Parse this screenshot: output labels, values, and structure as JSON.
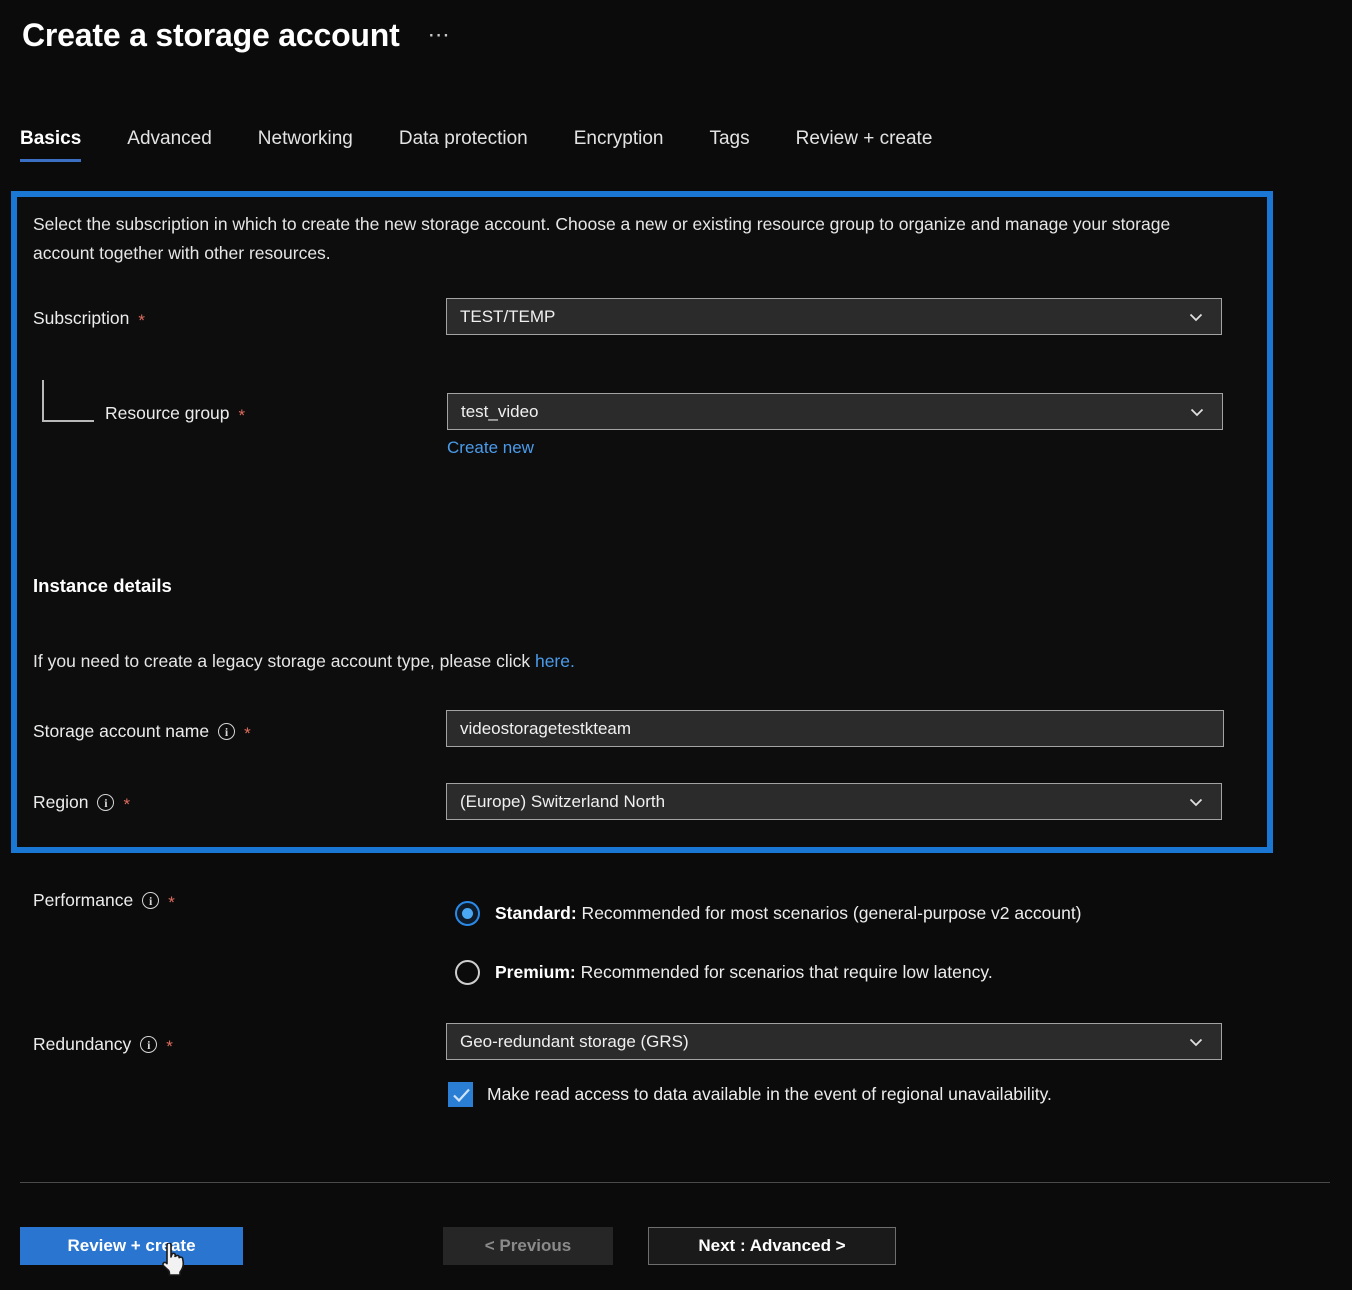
{
  "header": {
    "title": "Create a storage account",
    "more_label": "⋯"
  },
  "tabs": [
    {
      "label": "Basics",
      "active": true
    },
    {
      "label": "Advanced",
      "active": false
    },
    {
      "label": "Networking",
      "active": false
    },
    {
      "label": "Data protection",
      "active": false
    },
    {
      "label": "Encryption",
      "active": false
    },
    {
      "label": "Tags",
      "active": false
    },
    {
      "label": "Review + create",
      "active": false
    }
  ],
  "basics": {
    "intro": "Select the subscription in which to create the new storage account. Choose a new or existing resource group to organize and manage your storage account together with other resources.",
    "subscription": {
      "label": "Subscription",
      "required": "*",
      "value": "TEST/TEMP"
    },
    "resource_group": {
      "label": "Resource group",
      "required": "*",
      "value": "test_video",
      "create_new_link": "Create new"
    },
    "instance_details": {
      "heading": "Instance details",
      "legacy_note_prefix": "If you need to create a legacy storage account type, please click ",
      "legacy_note_link": "here.",
      "storage_account_name": {
        "label": "Storage account name",
        "required": "*",
        "value": "videostoragetestkteam"
      },
      "region": {
        "label": "Region",
        "required": "*",
        "value": "(Europe) Switzerland North"
      }
    },
    "performance": {
      "label": "Performance",
      "required": "*",
      "options": [
        {
          "bold": "Standard:",
          "text": " Recommended for most scenarios (general-purpose v2 account)",
          "selected": true
        },
        {
          "bold": "Premium:",
          "text": " Recommended for scenarios that require low latency.",
          "selected": false
        }
      ]
    },
    "redundancy": {
      "label": "Redundancy",
      "required": "*",
      "value": "Geo-redundant storage (GRS)",
      "checkbox_label": "Make read access to data available in the event of regional unavailability.",
      "checkbox_checked": true
    }
  },
  "footer": {
    "review_create": "Review + create",
    "previous": "< Previous",
    "next": "Next : Advanced >"
  },
  "colors": {
    "accent_blue": "#2a75d0",
    "highlight_border": "#1b77d4",
    "link_blue": "#4a9bea",
    "required_red": "#e06c5e",
    "background": "#0b0b0b"
  },
  "icons": {
    "chevron_down": "chevron-down-icon",
    "info": "info-icon",
    "check": "check-icon",
    "cursor": "hand-pointer-cursor"
  }
}
